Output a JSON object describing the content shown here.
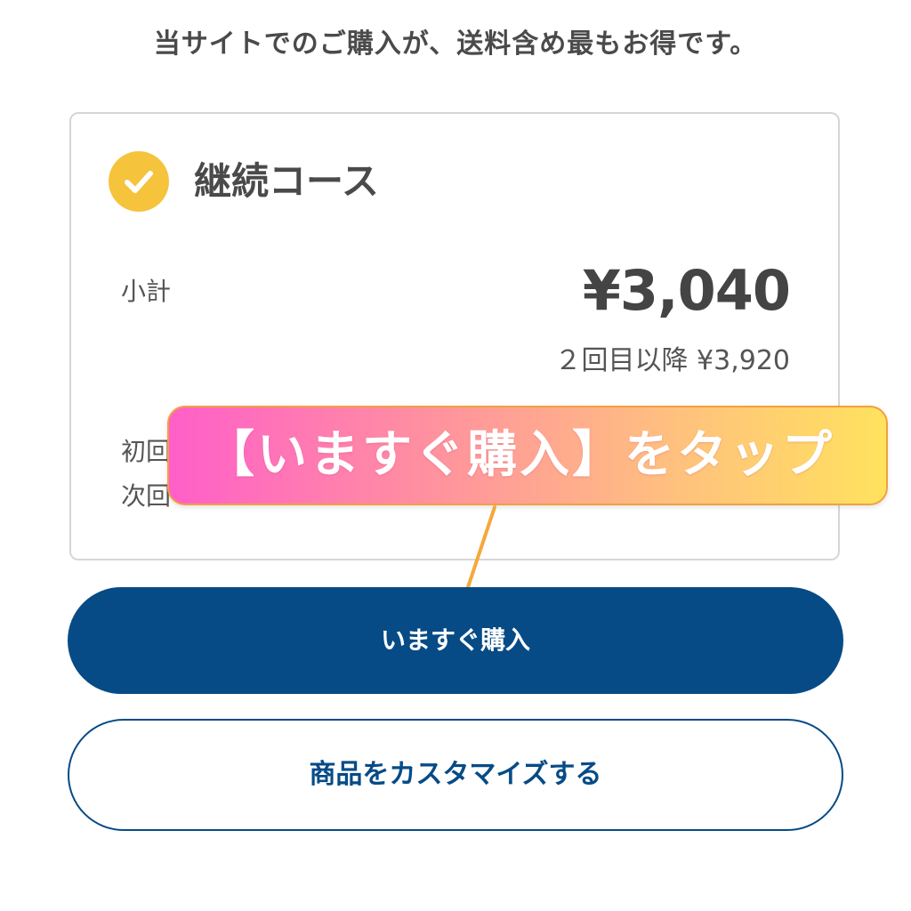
{
  "tagline": "当サイトでのご購入が、送料含め最もお得です。",
  "course": {
    "title": "継続コース",
    "check_icon": "check-icon",
    "subtotal_label": "小計",
    "price": "¥3,040",
    "next_price": "２回目以降 ¥3,920",
    "row1_label": "初回",
    "row2_label": "次回"
  },
  "callout": {
    "text": "【いますぐ購入】をタップ"
  },
  "buttons": {
    "buy_label": "いますぐ購入",
    "customize_label": "商品をカスタマイズする"
  },
  "colors": {
    "accent_navy": "#064b86",
    "check_yellow": "#f5c43c",
    "arrow_orange": "#f5a83a"
  }
}
